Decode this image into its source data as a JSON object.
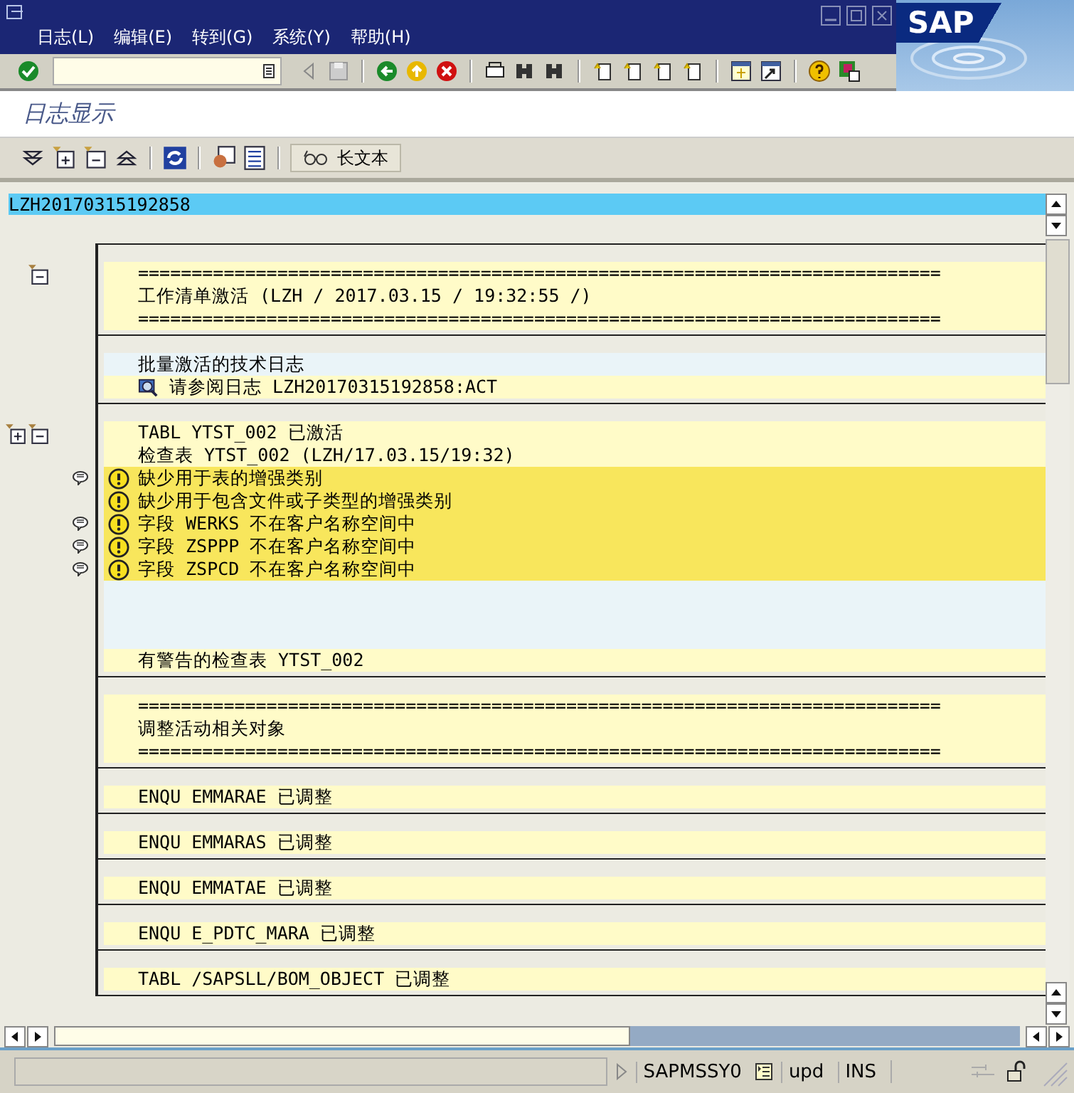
{
  "menu": [
    "日志(L)",
    "编辑(E)",
    "转到(G)",
    "系统(Y)",
    "帮助(H)"
  ],
  "logo": "SAP",
  "screen_title": "日志显示",
  "app_toolbar": {
    "long_text_button": "长文本"
  },
  "log_name": "LZH20170315192858",
  "blocks": [
    {
      "lines": [
        {
          "kind": "rule",
          "expandable": false,
          "collapsible": true,
          "message": false,
          "text": "==========================================================================="
        },
        {
          "kind": "text",
          "expandable": false,
          "collapsible": false,
          "message": false,
          "text": "工作清单激活 (LZH / 2017.03.15 / 19:32:55 /)"
        },
        {
          "kind": "rule",
          "expandable": false,
          "collapsible": false,
          "message": false,
          "text": "==========================================================================="
        }
      ]
    },
    {
      "lines": [
        {
          "kind": "note",
          "expandable": false,
          "collapsible": false,
          "message": false,
          "text": "批量激活的技术日志"
        },
        {
          "kind": "link",
          "expandable": false,
          "collapsible": false,
          "message": false,
          "text": "请参阅日志 LZH20170315192858:ACT"
        }
      ]
    },
    {
      "lines": [
        {
          "kind": "text",
          "expandable": true,
          "collapsible": true,
          "message": false,
          "text": "TABL YTST_002 已激活"
        },
        {
          "kind": "text",
          "expandable": false,
          "collapsible": false,
          "message": false,
          "text": "检查表 YTST_002 (LZH/17.03.15/19:32)"
        },
        {
          "kind": "warning",
          "expandable": false,
          "collapsible": false,
          "message": true,
          "text": "缺少用于表的增强类别"
        },
        {
          "kind": "warning",
          "expandable": false,
          "collapsible": false,
          "message": false,
          "text": "缺少用于包含文件或子类型的增强类别"
        },
        {
          "kind": "warning",
          "expandable": false,
          "collapsible": false,
          "message": true,
          "text": "字段 WERKS 不在客户名称空间中"
        },
        {
          "kind": "warning",
          "expandable": false,
          "collapsible": false,
          "message": true,
          "text": "字段 ZSPPP 不在客户名称空间中"
        },
        {
          "kind": "warning",
          "expandable": false,
          "collapsible": false,
          "message": true,
          "text": "字段 ZSPCD 不在客户名称空间中"
        },
        {
          "kind": "blank",
          "expandable": false,
          "collapsible": false,
          "message": false
        },
        {
          "kind": "blank",
          "expandable": false,
          "collapsible": false,
          "message": false
        },
        {
          "kind": "blank",
          "expandable": false,
          "collapsible": false,
          "message": false
        },
        {
          "kind": "text",
          "expandable": false,
          "collapsible": false,
          "message": false,
          "text": "有警告的检查表 YTST_002"
        }
      ]
    },
    {
      "lines": [
        {
          "kind": "rule",
          "expandable": false,
          "collapsible": false,
          "message": false,
          "text": "==========================================================================="
        },
        {
          "kind": "text",
          "expandable": false,
          "collapsible": false,
          "message": false,
          "text": "调整活动相关对象"
        },
        {
          "kind": "rule",
          "expandable": false,
          "collapsible": false,
          "message": false,
          "text": "==========================================================================="
        }
      ]
    },
    {
      "lines": [
        {
          "kind": "text",
          "expandable": false,
          "collapsible": false,
          "message": false,
          "text": "ENQU EMMARAE 已调整"
        }
      ]
    },
    {
      "lines": [
        {
          "kind": "text",
          "expandable": false,
          "collapsible": false,
          "message": false,
          "text": "ENQU EMMARAS 已调整"
        }
      ]
    },
    {
      "lines": [
        {
          "kind": "text",
          "expandable": false,
          "collapsible": false,
          "message": false,
          "text": "ENQU EMMATAE 已调整"
        }
      ]
    },
    {
      "lines": [
        {
          "kind": "text",
          "expandable": false,
          "collapsible": false,
          "message": false,
          "text": "ENQU E_PDTC_MARA 已调整"
        }
      ]
    },
    {
      "lines": [
        {
          "kind": "text",
          "expandable": false,
          "collapsible": false,
          "message": false,
          "text": "TABL /SAPSLL/BOM_OBJECT 已调整"
        }
      ]
    }
  ],
  "status_bar": {
    "program": "SAPMSSY0",
    "mode": "upd",
    "insert": "INS"
  }
}
